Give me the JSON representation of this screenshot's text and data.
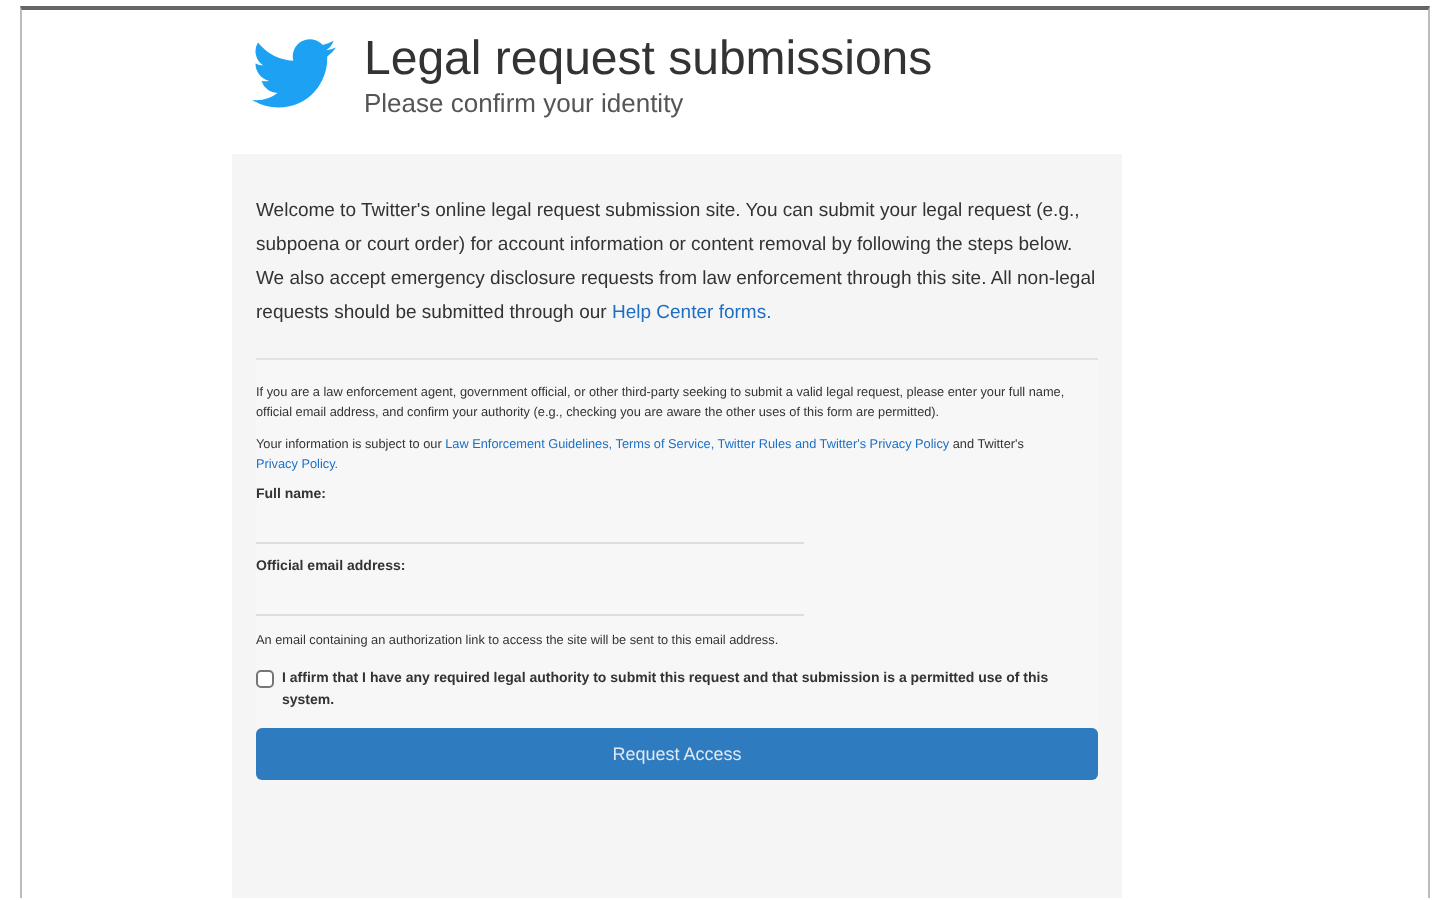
{
  "header": {
    "title": "Legal request submissions",
    "subtitle": "Please confirm your identity"
  },
  "intro": {
    "text": "Welcome to Twitter's online legal request submission site. You can submit your legal request (e.g., subpoena or court order) for account information or content removal by following the steps below. We also accept emergency disclosure requests from law enforcement through this site. All non-legal requests should be submitted through our",
    "link": "Help Center forms."
  },
  "instructions": "If you are a law enforcement agent, government official, or other third-party seeking to submit a valid legal request, please enter your full name, official email address, and confirm your authority (e.g., checking you are aware the other uses of this form are permitted).",
  "policy": {
    "text": "Your information is subject to our",
    "link": "Law Enforcement Guidelines, Terms of Service, Twitter Rules and Twitter's Privacy Policy",
    "after": "and Twitter's",
    "link2": "Privacy Policy."
  },
  "fields": [
    {
      "label": "Full name:"
    },
    {
      "label": "Official email address:"
    }
  ],
  "email_note": "An email containing an authorization link to access the site will be sent to this email address.",
  "affirm": {
    "text": "I affirm that I have any required legal authority to submit this request and that submission is a permitted use of this system.",
    "checked": false
  },
  "submit": "Request Access"
}
